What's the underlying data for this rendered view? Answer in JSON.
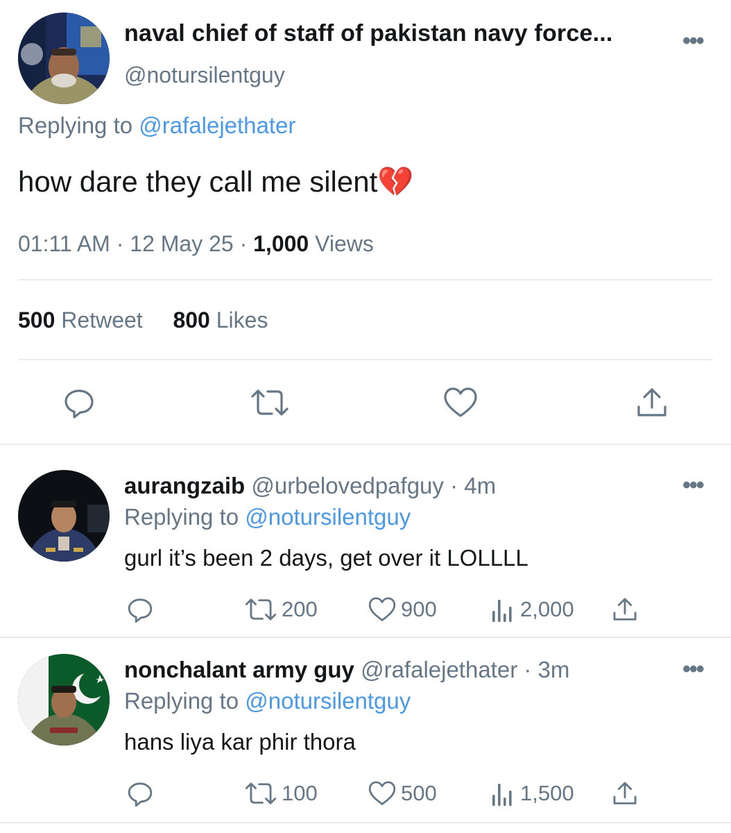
{
  "main_tweet": {
    "display_name": "naval chief of staff of pakistan navy force...",
    "handle": "@notursilentguy",
    "replying_prefix": "Replying to",
    "replying_to": "@rafalejethater",
    "text": "how dare they call me silent💔",
    "time": "01:11 AM",
    "date": "12 May 25",
    "views_count": "1,000",
    "views_label": "Views",
    "retweets_count": "500",
    "retweets_label": "Retweet",
    "likes_count": "800",
    "likes_label": "Likes"
  },
  "replies": [
    {
      "display_name": "aurangzaib",
      "handle": "@urbelovedpafguy",
      "time": "4m",
      "replying_prefix": "Replying to",
      "replying_to": "@notursilentguy",
      "text": "gurl it’s been 2 days, get over it LOLLLL",
      "retweets": "200",
      "likes": "900",
      "views": "2,000"
    },
    {
      "display_name": "nonchalant army guy",
      "handle": "@rafalejethater",
      "time": "3m",
      "replying_prefix": "Replying to",
      "replying_to": "@notursilentguy",
      "text": "hans liya kar phir thora",
      "retweets": "100",
      "likes": "500",
      "views": "1,500"
    }
  ],
  "colors": {
    "link_blue": "#4a99e9",
    "secondary_gray": "#657786",
    "divider": "#e6ecf0"
  }
}
